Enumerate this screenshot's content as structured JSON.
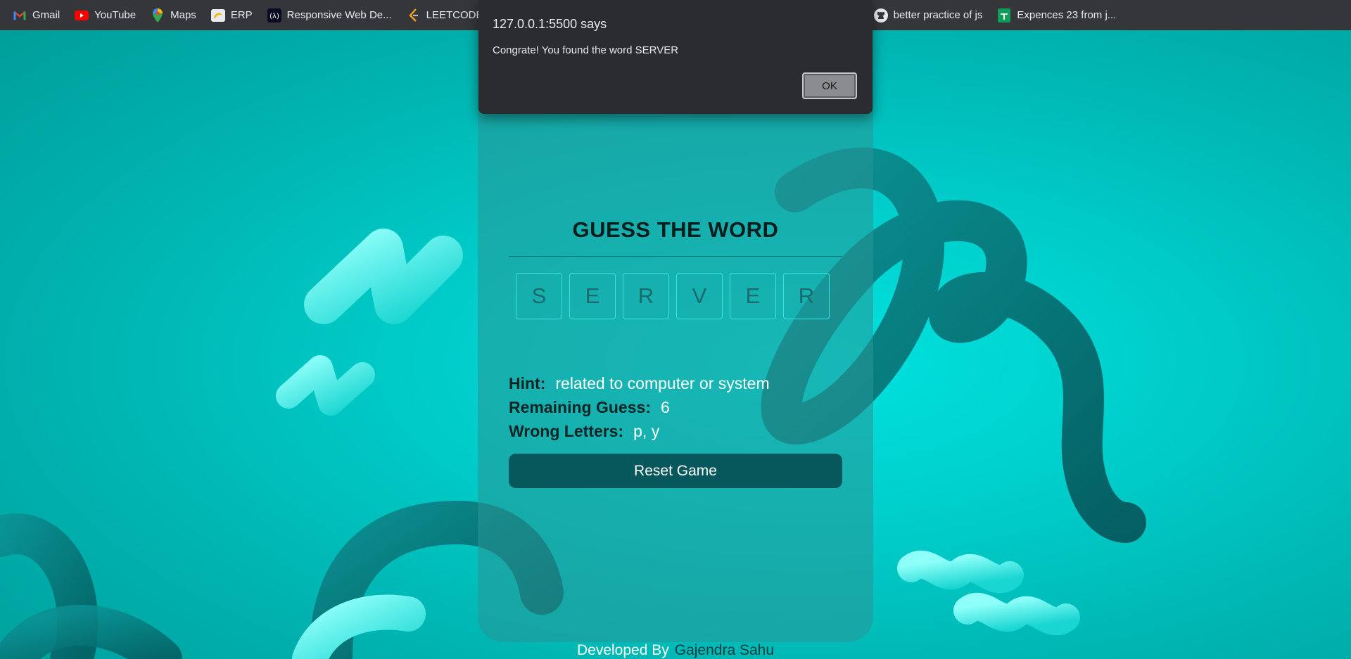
{
  "bookmarks": [
    {
      "label": "Gmail",
      "icon": "gmail-icon"
    },
    {
      "label": "YouTube",
      "icon": "youtube-icon"
    },
    {
      "label": "Maps",
      "icon": "maps-icon"
    },
    {
      "label": "ERP",
      "icon": "erp-icon"
    },
    {
      "label": "Responsive Web De...",
      "icon": "freecodecamp-icon"
    },
    {
      "label": "LEETCODE P",
      "icon": "leetcode-icon"
    },
    {
      "label": "better practice of js",
      "icon": "github-icon"
    },
    {
      "label": "Expences 23 from j...",
      "icon": "sheets-icon"
    }
  ],
  "dialog": {
    "title": "127.0.0.1:5500 says",
    "message": "Congrate! You found the word SERVER",
    "ok_label": "OK"
  },
  "game": {
    "title": "GUESS THE WORD",
    "letters": [
      "S",
      "E",
      "R",
      "V",
      "E",
      "R"
    ],
    "hint_label": "Hint:",
    "hint_value": "related to computer or system",
    "remaining_label": "Remaining Guess:",
    "remaining_value": "6",
    "wrong_label": "Wrong Letters:",
    "wrong_value": "p, y",
    "reset_label": "Reset Game"
  },
  "footer": {
    "prefix": "Developed By",
    "author": "Gajendra Sahu"
  },
  "colors": {
    "bookmarks_bar": "#35363a",
    "card_button": "#06585c",
    "letter_border": "#35e6e0"
  }
}
